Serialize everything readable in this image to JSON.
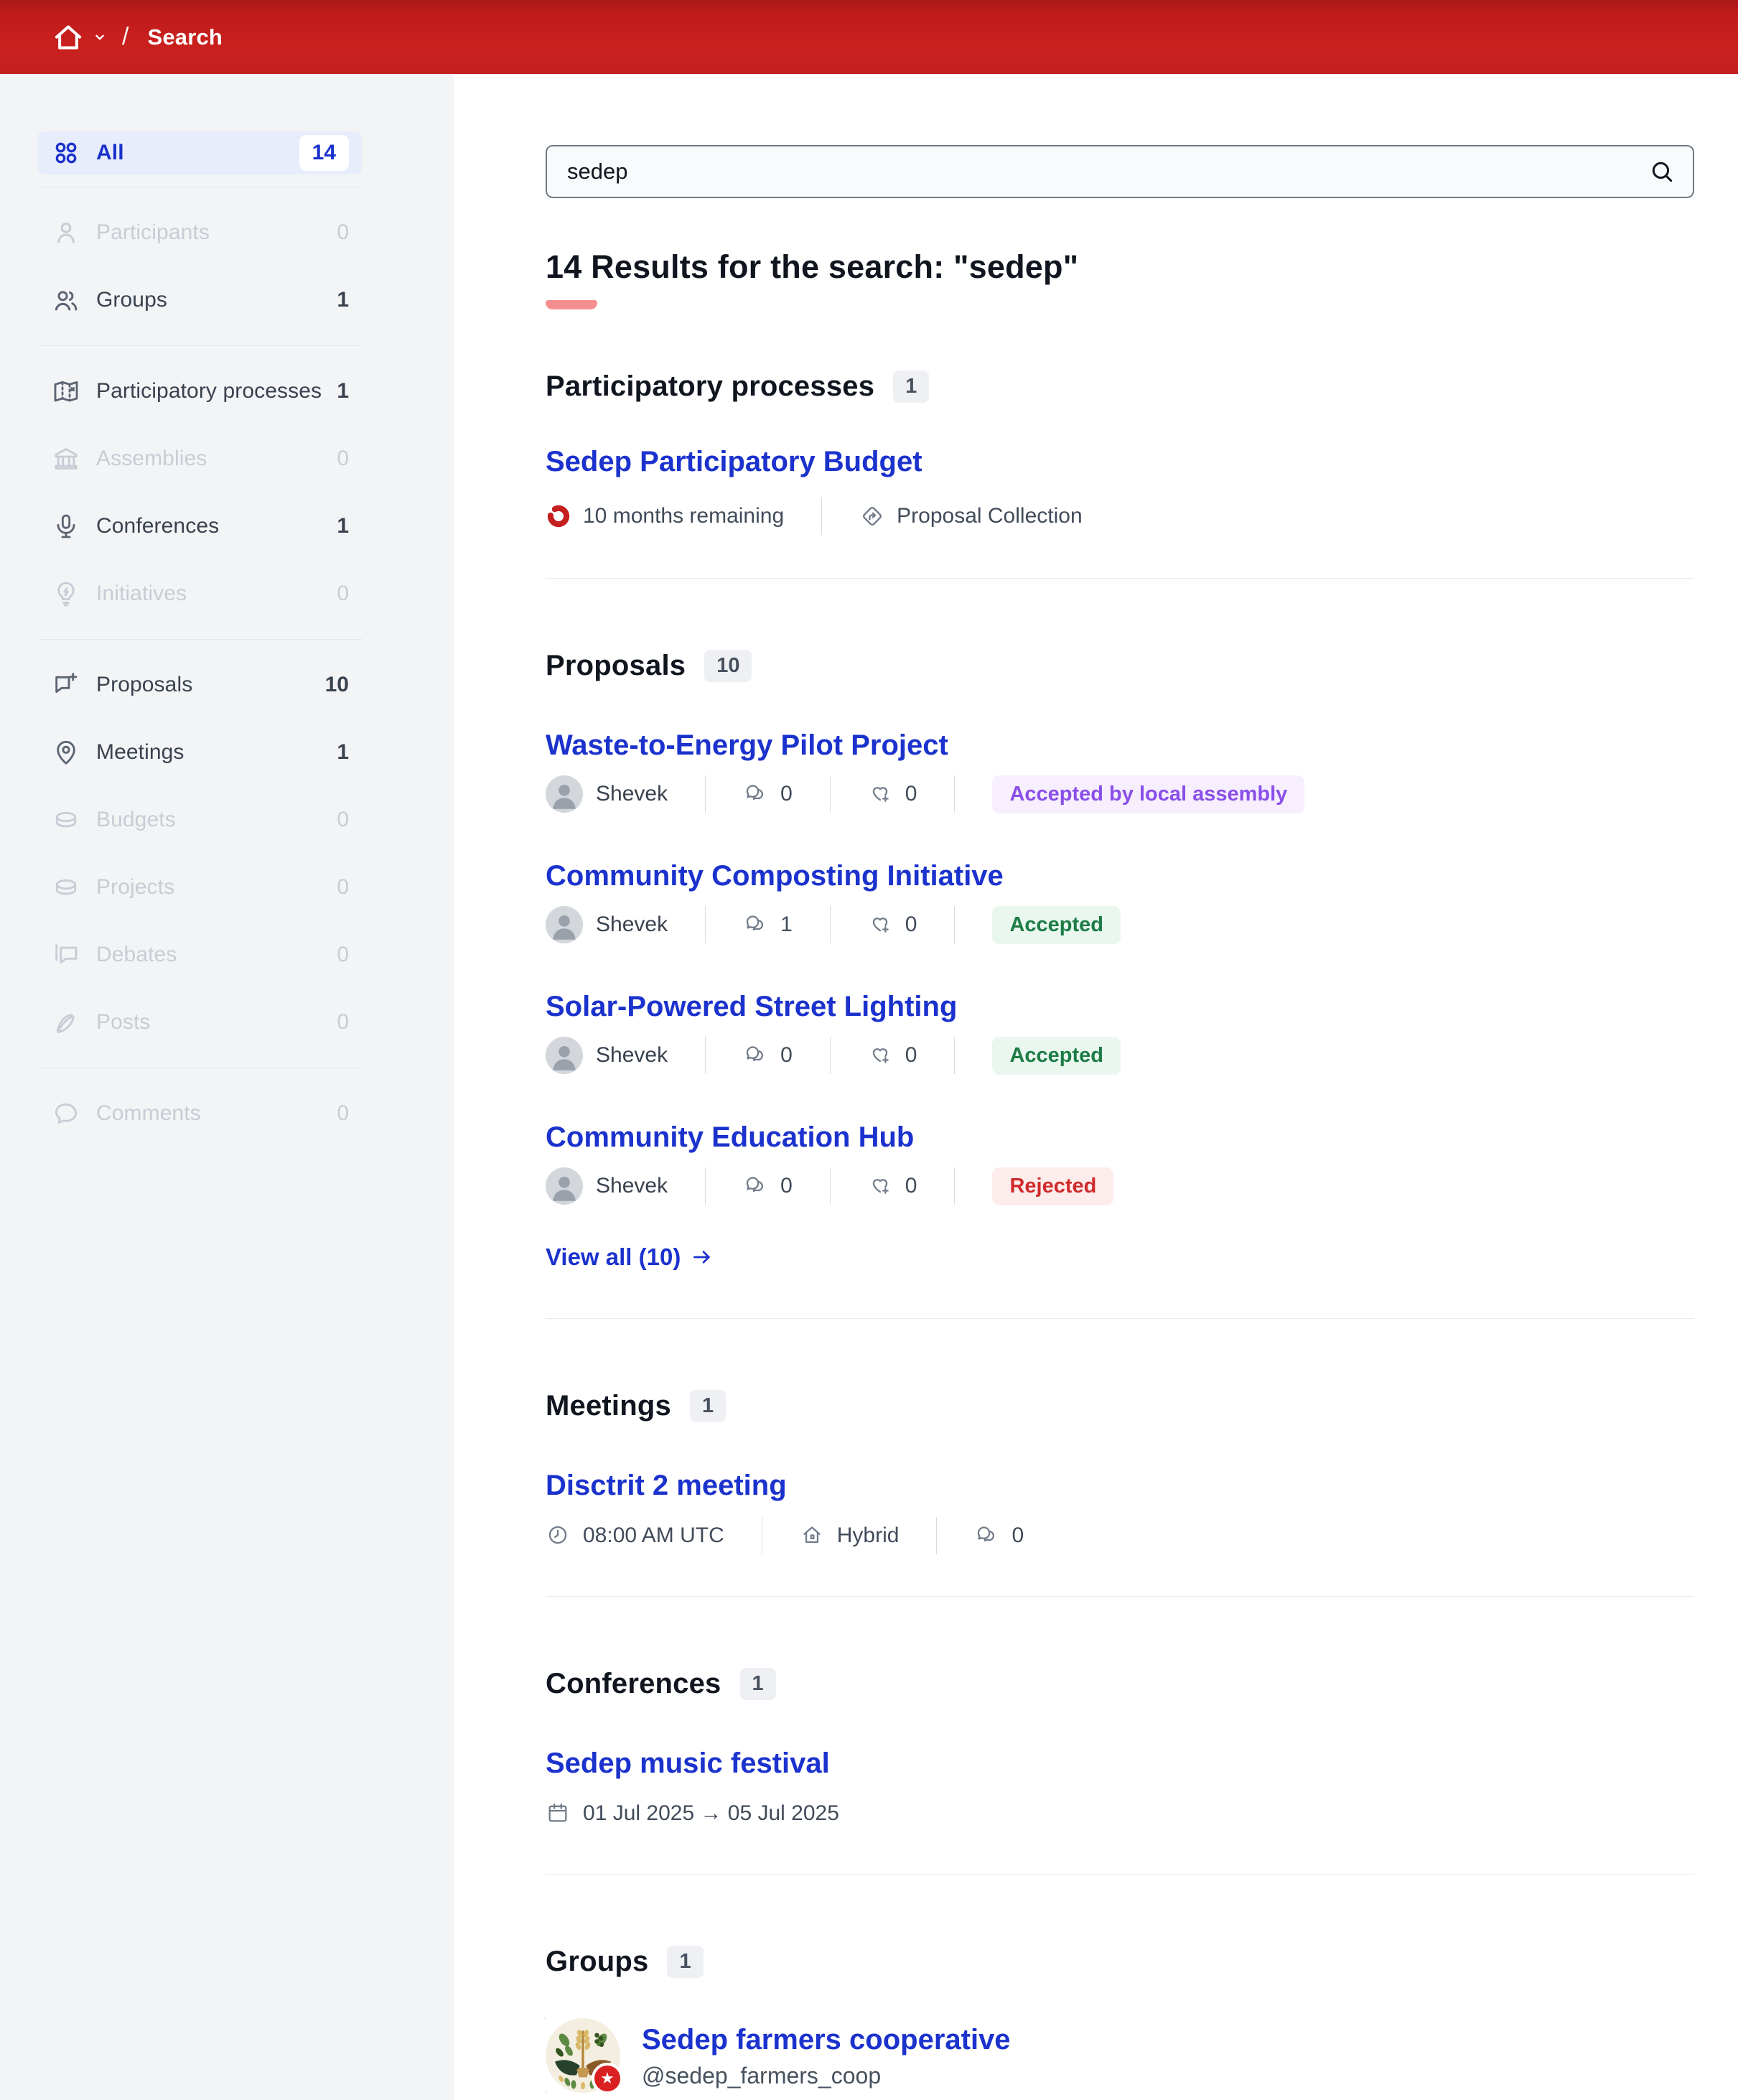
{
  "colors": {
    "header_red": "#c9201e",
    "link_blue": "#1b32cd",
    "heading_underline": "#f58f8f",
    "accepted_text": "#1d7c46",
    "accepted_bg": "#e9f7ee",
    "rejected_text": "#d02b2b",
    "rejected_bg": "#fdecec",
    "assembly_text": "#8a4fe8",
    "assembly_bg": "#f7eefe",
    "sidebar_bg": "#f3f4f6"
  },
  "header": {
    "breadcrumb_sep": "/",
    "breadcrumb": "Search"
  },
  "sidebar": {
    "items": [
      {
        "label": "All",
        "count": "14"
      },
      {
        "label": "Participants",
        "count": "0"
      },
      {
        "label": "Groups",
        "count": "1"
      },
      {
        "label": "Participatory processes",
        "count": "1"
      },
      {
        "label": "Assemblies",
        "count": "0"
      },
      {
        "label": "Conferences",
        "count": "1"
      },
      {
        "label": "Initiatives",
        "count": "0"
      },
      {
        "label": "Proposals",
        "count": "10"
      },
      {
        "label": "Meetings",
        "count": "1"
      },
      {
        "label": "Budgets",
        "count": "0"
      },
      {
        "label": "Projects",
        "count": "0"
      },
      {
        "label": "Debates",
        "count": "0"
      },
      {
        "label": "Posts",
        "count": "0"
      },
      {
        "label": "Comments",
        "count": "0"
      }
    ]
  },
  "search": {
    "value": "sedep"
  },
  "results": {
    "heading": "14 Results for the search: \"sedep\""
  },
  "processes": {
    "title": "Participatory processes",
    "count": "1",
    "item": {
      "title": "Sedep Participatory Budget",
      "remaining": "10 months remaining",
      "phase": "Proposal Collection"
    }
  },
  "proposals": {
    "title": "Proposals",
    "count": "10",
    "view_all": "View all (10)",
    "items": [
      {
        "title": "Waste-to-Energy Pilot Project",
        "author": "Shevek",
        "comments": "0",
        "endorsements": "0",
        "status": "Accepted by local assembly"
      },
      {
        "title": "Community Composting Initiative",
        "author": "Shevek",
        "comments": "1",
        "endorsements": "0",
        "status": "Accepted"
      },
      {
        "title": "Solar-Powered Street Lighting",
        "author": "Shevek",
        "comments": "0",
        "endorsements": "0",
        "status": "Accepted"
      },
      {
        "title": "Community Education Hub",
        "author": "Shevek",
        "comments": "0",
        "endorsements": "0",
        "status": "Rejected"
      }
    ]
  },
  "meetings": {
    "title": "Meetings",
    "count": "1",
    "item": {
      "title": "Disctrit 2 meeting",
      "time": "08:00 AM UTC",
      "mode": "Hybrid",
      "comments": "0"
    }
  },
  "conferences": {
    "title": "Conferences",
    "count": "1",
    "item": {
      "title": "Sedep music festival",
      "dates": "01 Jul 2025 → 05 Jul 2025"
    }
  },
  "groups": {
    "title": "Groups",
    "count": "1",
    "item": {
      "title": "Sedep farmers cooperative",
      "handle": "@sedep_farmers_coop"
    }
  }
}
